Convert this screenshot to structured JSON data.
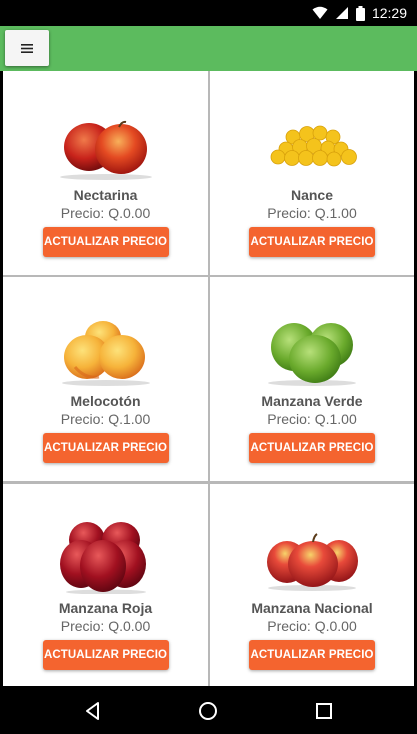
{
  "status_bar": {
    "time": "12:29",
    "icons": [
      "wifi-icon",
      "signal-icon",
      "battery-icon"
    ]
  },
  "app_bar": {
    "menu_icon": "hamburger-menu-icon",
    "color": "#5cbb5e"
  },
  "colors": {
    "button": "#f4642f",
    "app_bar": "#5cbb5e"
  },
  "products": [
    {
      "name": "Nectarina",
      "price": "Precio: Q.0.00",
      "button": "ACTUALIZAR PRECIO",
      "image": "nectarine-image"
    },
    {
      "name": "Nance",
      "price": "Precio: Q.1.00",
      "button": "ACTUALIZAR PRECIO",
      "image": "nance-image"
    },
    {
      "name": "Melocotón",
      "price": "Precio: Q.1.00",
      "button": "ACTUALIZAR PRECIO",
      "image": "peach-image"
    },
    {
      "name": "Manzana Verde",
      "price": "Precio: Q.1.00",
      "button": "ACTUALIZAR PRECIO",
      "image": "green-apple-image"
    },
    {
      "name": "Manzana Roja",
      "price": "Precio: Q.0.00",
      "button": "ACTUALIZAR PRECIO",
      "image": "red-apple-image"
    },
    {
      "name": "Manzana Nacional",
      "price": "Precio: Q.0.00",
      "button": "ACTUALIZAR PRECIO",
      "image": "national-apple-image"
    }
  ],
  "nav_bar": {
    "icons": [
      "back-icon",
      "home-icon",
      "recents-icon"
    ]
  }
}
